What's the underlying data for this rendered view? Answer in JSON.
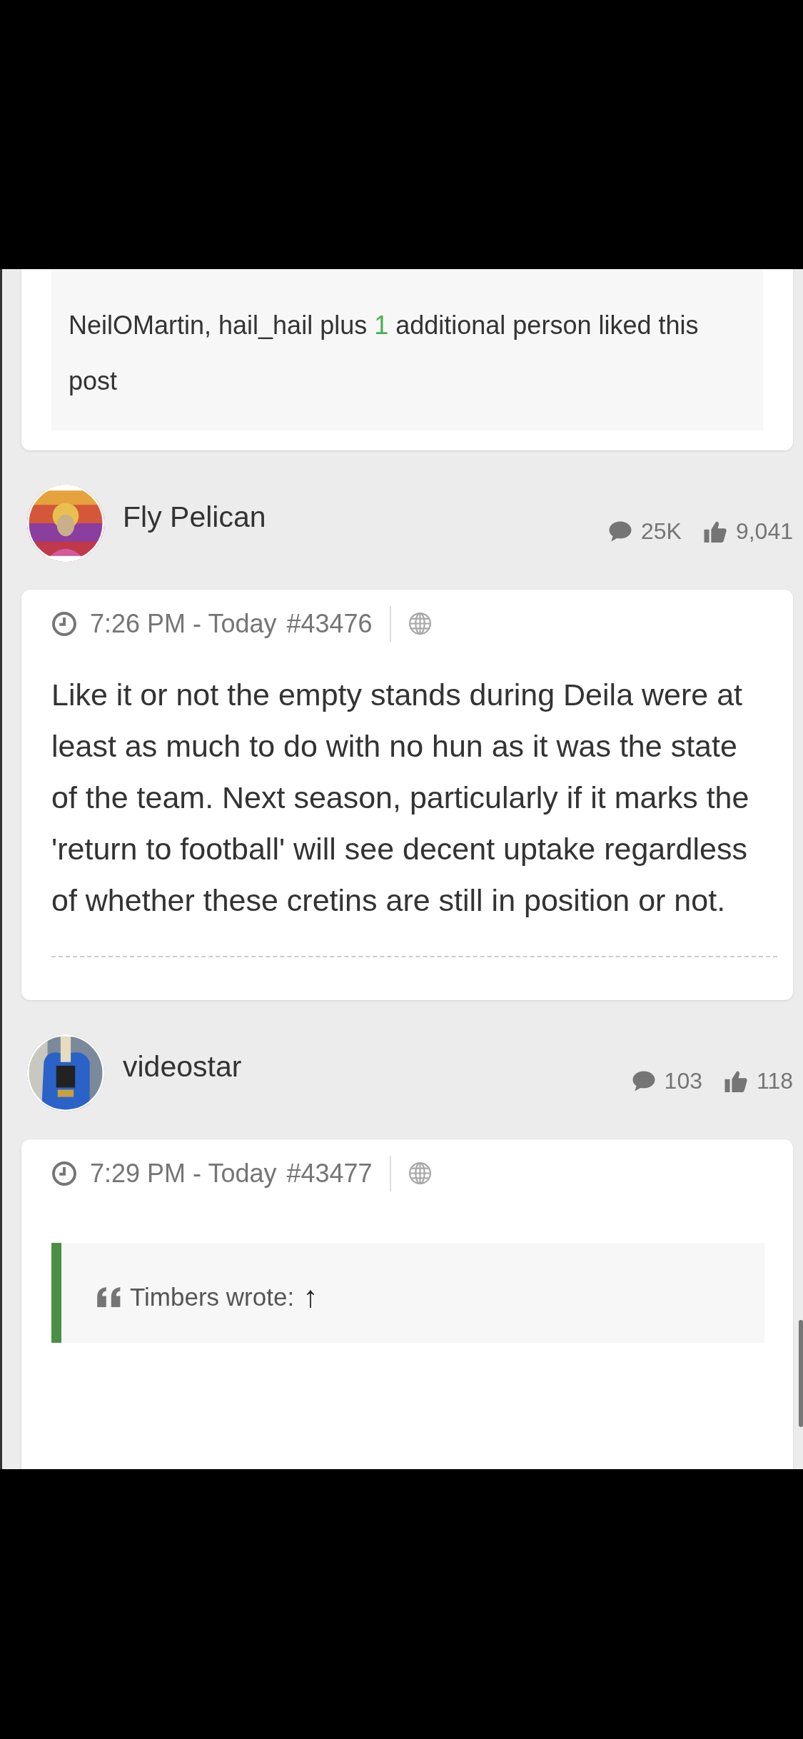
{
  "likes_box": {
    "before": "NeilOMartin, hail_hail plus ",
    "count": "1",
    "after": " additional person liked this post"
  },
  "posts": [
    {
      "author": "Fly Pelican",
      "comments": "25K",
      "likes": "9,041",
      "time": "7:26 PM - Today",
      "number": "#43476",
      "body": "Like it or not the empty stands during Deila were at least as much to do with no hun as it was the state of the team. Next season, particularly if it marks the 'return to football' will see decent uptake regardless of whether these cretins are still in position or not."
    },
    {
      "author": "videostar",
      "comments": "103",
      "likes": "118",
      "time": "7:29 PM - Today",
      "number": "#43477",
      "quote": {
        "author": "Timbers wrote:",
        "arrow": "↑"
      }
    }
  ]
}
